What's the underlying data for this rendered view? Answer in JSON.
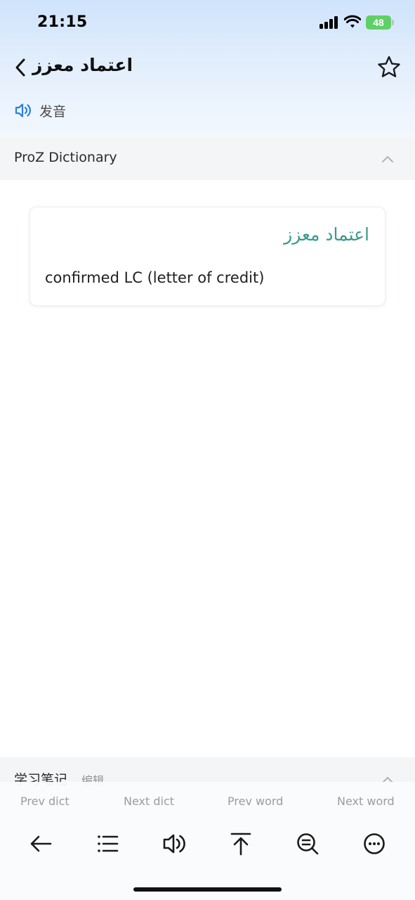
{
  "status_bar": {
    "time": "21:15",
    "battery_level": "48",
    "battery_color": "#5fd068"
  },
  "header": {
    "back_icon": "chevron-left-icon",
    "word": "اعتماد معزز",
    "favorite_icon": "star-outline-icon",
    "pronunciation_icon": "speaker-icon",
    "pronunciation_label": "发音"
  },
  "dictionary_section": {
    "title": "ProZ Dictionary",
    "collapse_icon": "chevron-up-icon",
    "entries": [
      {
        "term": "اعتماد معزز",
        "definition": "confirmed LC (letter of credit)"
      }
    ]
  },
  "notes_section": {
    "title": "学习笔记",
    "edit_label": "编辑",
    "collapse_icon": "chevron-up-icon"
  },
  "bottom_toolbar": {
    "nav_labels": {
      "prev_dict": "Prev dict",
      "next_dict": "Next dict",
      "prev_word": "Prev word",
      "next_word": "Next word"
    },
    "icons": [
      "arrow-left-icon",
      "list-icon",
      "speaker-icon",
      "scroll-to-top-icon",
      "search-in-page-icon",
      "more-icon"
    ]
  },
  "colors": {
    "accent_term": "#3a9a8c",
    "accent_blue": "#2b7fe0",
    "header_gradient_top": "#cfe3fb"
  }
}
